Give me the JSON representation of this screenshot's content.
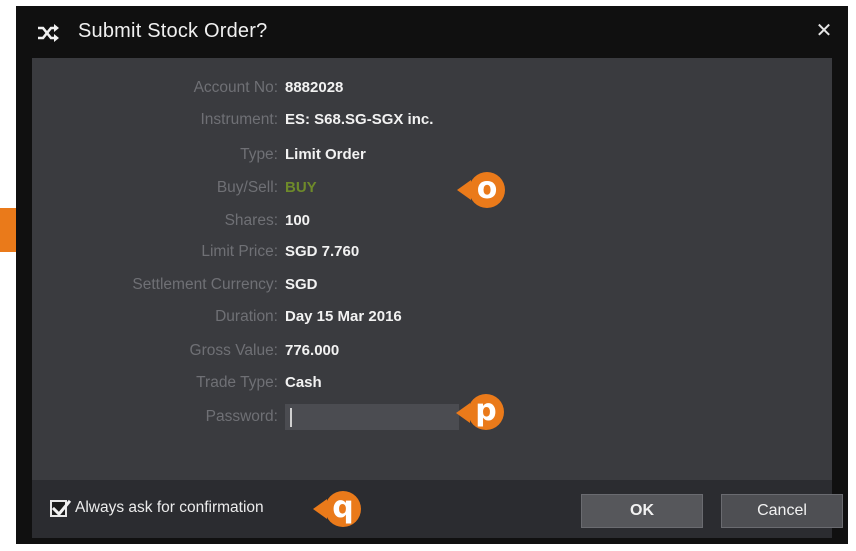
{
  "dialog": {
    "title": "Submit Stock Order?",
    "close_symbol": "✕",
    "icon": "shuffle-icon"
  },
  "order": {
    "rows": [
      {
        "label": "Account No:",
        "value": "8882028"
      },
      {
        "label": "Instrument:",
        "value": "ES: S68.SG-SGX inc."
      },
      {
        "label": "Type:",
        "value": "Limit Order"
      },
      {
        "label": "Buy/Sell:",
        "value": "BUY"
      },
      {
        "label": "Shares:",
        "value": "100"
      },
      {
        "label": "Limit Price:",
        "value": "SGD 7.760"
      },
      {
        "label": "Settlement Currency:",
        "value": "SGD"
      },
      {
        "label": "Duration:",
        "value": "Day 15 Mar 2016"
      },
      {
        "label": "Gross Value:",
        "value": "776.000"
      },
      {
        "label": "Trade Type:",
        "value": "Cash"
      }
    ],
    "password_label": "Password:",
    "password_value": ""
  },
  "footer": {
    "confirm_label": "Always ask for confirmation",
    "confirm_checked": true,
    "ok_label": "OK",
    "cancel_label": "Cancel"
  },
  "callouts": {
    "o": "o",
    "p": "p",
    "q": "q"
  },
  "colors": {
    "dialog_bg": "#101010",
    "panel_bg": "#3a3b3f",
    "footer_bg": "#2b2c30",
    "label_color": "#6f7075",
    "value_color": "#f2f2f2",
    "buy_color": "#6e8a2a",
    "callout_color": "#ea7a1a"
  }
}
